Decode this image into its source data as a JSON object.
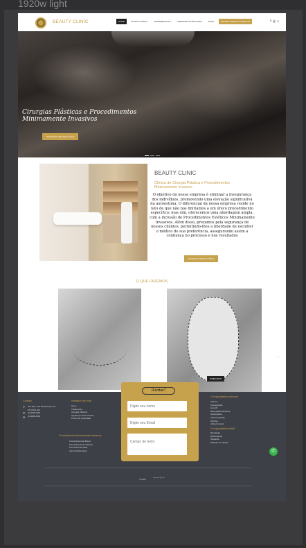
{
  "frame_title": "1920w light",
  "header": {
    "brand": "BEAUTY CLINIC",
    "nav": [
      "HOME",
      "CLÍNICA CLINICA",
      "TRATAMENTOS ▾",
      "CIRURGIAS PLÁSTICAS ▾",
      "BLOG"
    ],
    "cta": "AGENDE PREÇOS CONSULTA",
    "social": [
      "f",
      "◎",
      "⌕"
    ]
  },
  "hero": {
    "title_line1": "Cirurgias Plásticas e Procedimentos",
    "title_line2": "Minimamente Invasivos",
    "button": "SOLICITAR UMA AVALIAÇÃO"
  },
  "about": {
    "brand": "BEAUTY CLINIC",
    "subtitle": "Clínica de Cirurgia Plástica e Procedimentos Minimamente Invasivo",
    "body": "O objetivo da nossa empresa é eliminar a insegurança dos indivíduos, promovendo uma elevação significativa da autoestima. O diferencial da nossa empresa reside no fato de que não nos limitamos a um único procedimento específico: mas sim, oferecemos uma abordagem ampla, com a inclusão de Procedimentos Estéticos Minimamente Invasivos. Além disso, prezamos pela segurança de nossos clientes, permitindo-lhes a liberdade de escolher o médico de sua preferência, assegurando assim a confiança no processo e nos resultados",
    "button": "CONHEÇA NOSSA CLÍNICA"
  },
  "services": {
    "title": "O QUE FAZEMOS",
    "card_button": "SAIBA MAIS",
    "arrow": "›"
  },
  "footer": {
    "contact_title": "Contato",
    "contact": [
      "Rua Exp. José Mendes (PH, sal.",
      "SP 17021-921",
      "(11)0000-0000",
      "(11)0000-0000"
    ],
    "nav_title": "Navegue pelo site",
    "nav_links": [
      "Home",
      "Tratamentos",
      "Cirurgias Plásticas",
      "Agende já nossa consulta",
      "Política de privacidade"
    ],
    "proc_title": "Procedimento Minimamente Invasivos",
    "proc_links": [
      "Toxina Botulínica (Botox)",
      "Preenchimento de Olheiras",
      "Preenchimento labial",
      "Harmonização facial"
    ],
    "body_title": "Cirurgia plástica corporal",
    "body_links": [
      "Abdome",
      "Lipoaspiração",
      "Lipo HD",
      "Mamoplastia Redutora",
      "Gluteoplastia",
      "Abdominoplastia",
      "Hidrolipo",
      "Lifting Corporal"
    ],
    "face_title": "Cirurgia plástica facial",
    "face_links": [
      "Rinoplastia",
      "Blefaroplastia",
      "Otoplastia",
      "Redução de Papada"
    ],
    "form": {
      "title": "Dúvidas?",
      "name_placeholder": "Digite seu nome",
      "email_placeholder": "Digite seu Email",
      "text_placeholder": "Campo de texto"
    },
    "copyright": "© 2023"
  }
}
